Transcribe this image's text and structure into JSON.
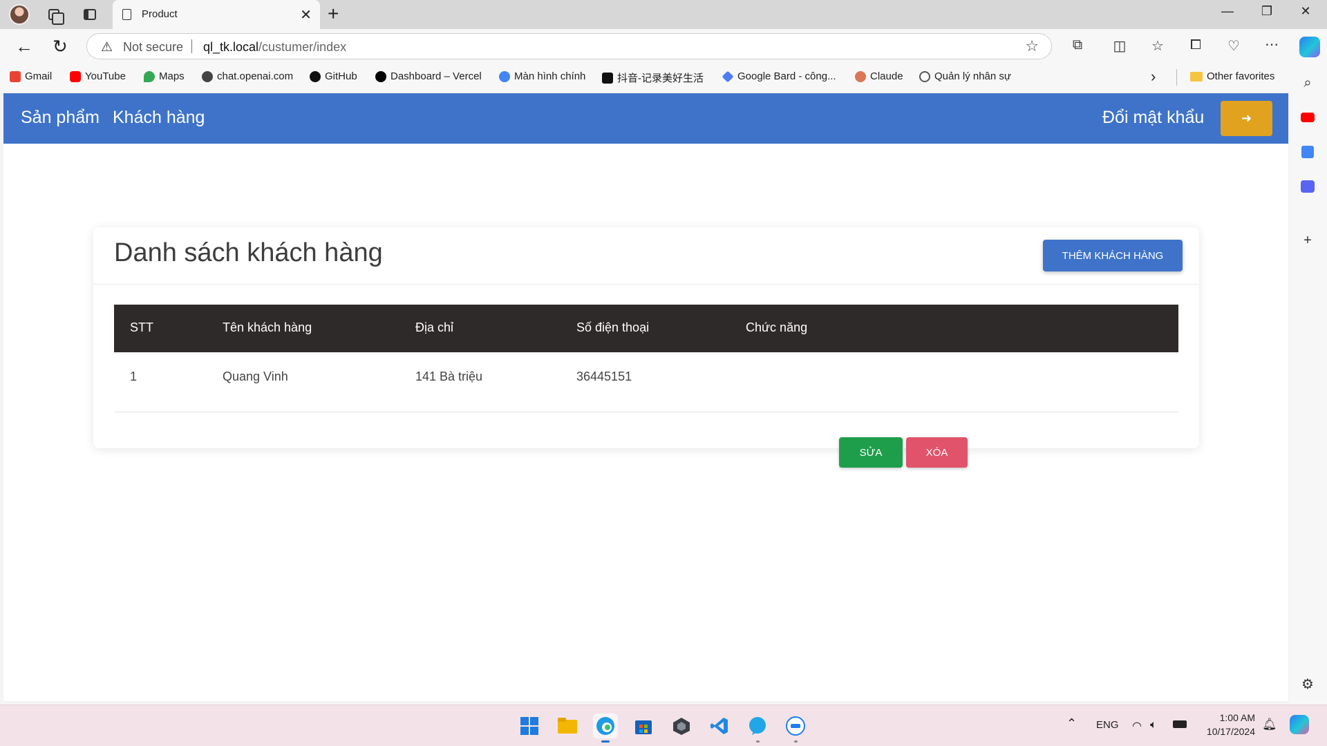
{
  "browser": {
    "tab_title": "Product",
    "tab_close": "✕",
    "new_tab": "+",
    "window": {
      "minimize": "—",
      "restore": "❐",
      "close": "✕"
    },
    "address": {
      "security_label": "Not secure",
      "host": "ql_tk.local",
      "path": "/custumer/index"
    },
    "bookmarks": [
      {
        "label": "Gmail",
        "icon": "gmail-icon",
        "color": "#ea4335"
      },
      {
        "label": "YouTube",
        "icon": "youtube-icon",
        "color": "#ff0000"
      },
      {
        "label": "Maps",
        "icon": "maps-icon",
        "color": "#34a853"
      },
      {
        "label": "chat.openai.com",
        "icon": "openai-icon",
        "color": "#444444"
      },
      {
        "label": "GitHub",
        "icon": "github-icon",
        "color": "#111111"
      },
      {
        "label": "Dashboard – Vercel",
        "icon": "vercel-icon",
        "color": "#000000"
      },
      {
        "label": "Màn hình chính",
        "icon": "google-icon",
        "color": "#4285f4"
      },
      {
        "label": "抖音-记录美好生活",
        "icon": "tiktok-icon",
        "color": "#111111"
      },
      {
        "label": "Google Bard - công...",
        "icon": "bard-icon",
        "color": "#4c7cf3"
      },
      {
        "label": "Claude",
        "icon": "claude-icon",
        "color": "#d97757"
      },
      {
        "label": "Quản lý nhân sự",
        "icon": "hr-app-icon",
        "color": "#555555"
      }
    ],
    "other_favorites": "Other favorites"
  },
  "app": {
    "nav": {
      "products": "Sản phẩm",
      "customers": "Khách hàng",
      "change_password": "Đổi mật khẩu",
      "logout_icon": "➜"
    },
    "page_title": "Danh sách khách hàng",
    "add_button": "THÊM KHÁCH HÀNG",
    "table": {
      "columns": [
        "STT",
        "Tên khách hàng",
        "Địa chỉ",
        "Số điện thoại",
        "Chức năng"
      ],
      "rows": [
        {
          "stt": "1",
          "name": "Quang Vinh",
          "address": "141 Bà triệu",
          "phone": "36445151"
        }
      ],
      "edit_label": "SỬA",
      "delete_label": "XÓA"
    }
  },
  "taskbar": {
    "language": "ENG",
    "time": "1:00 AM",
    "date": "10/17/2024"
  },
  "colors": {
    "nav_bg": "#3e73c9",
    "logout_bg": "#e0a21f",
    "table_head_bg": "#2f2a2a",
    "edit_bg": "#1e9e4a",
    "delete_bg": "#e0536a"
  }
}
